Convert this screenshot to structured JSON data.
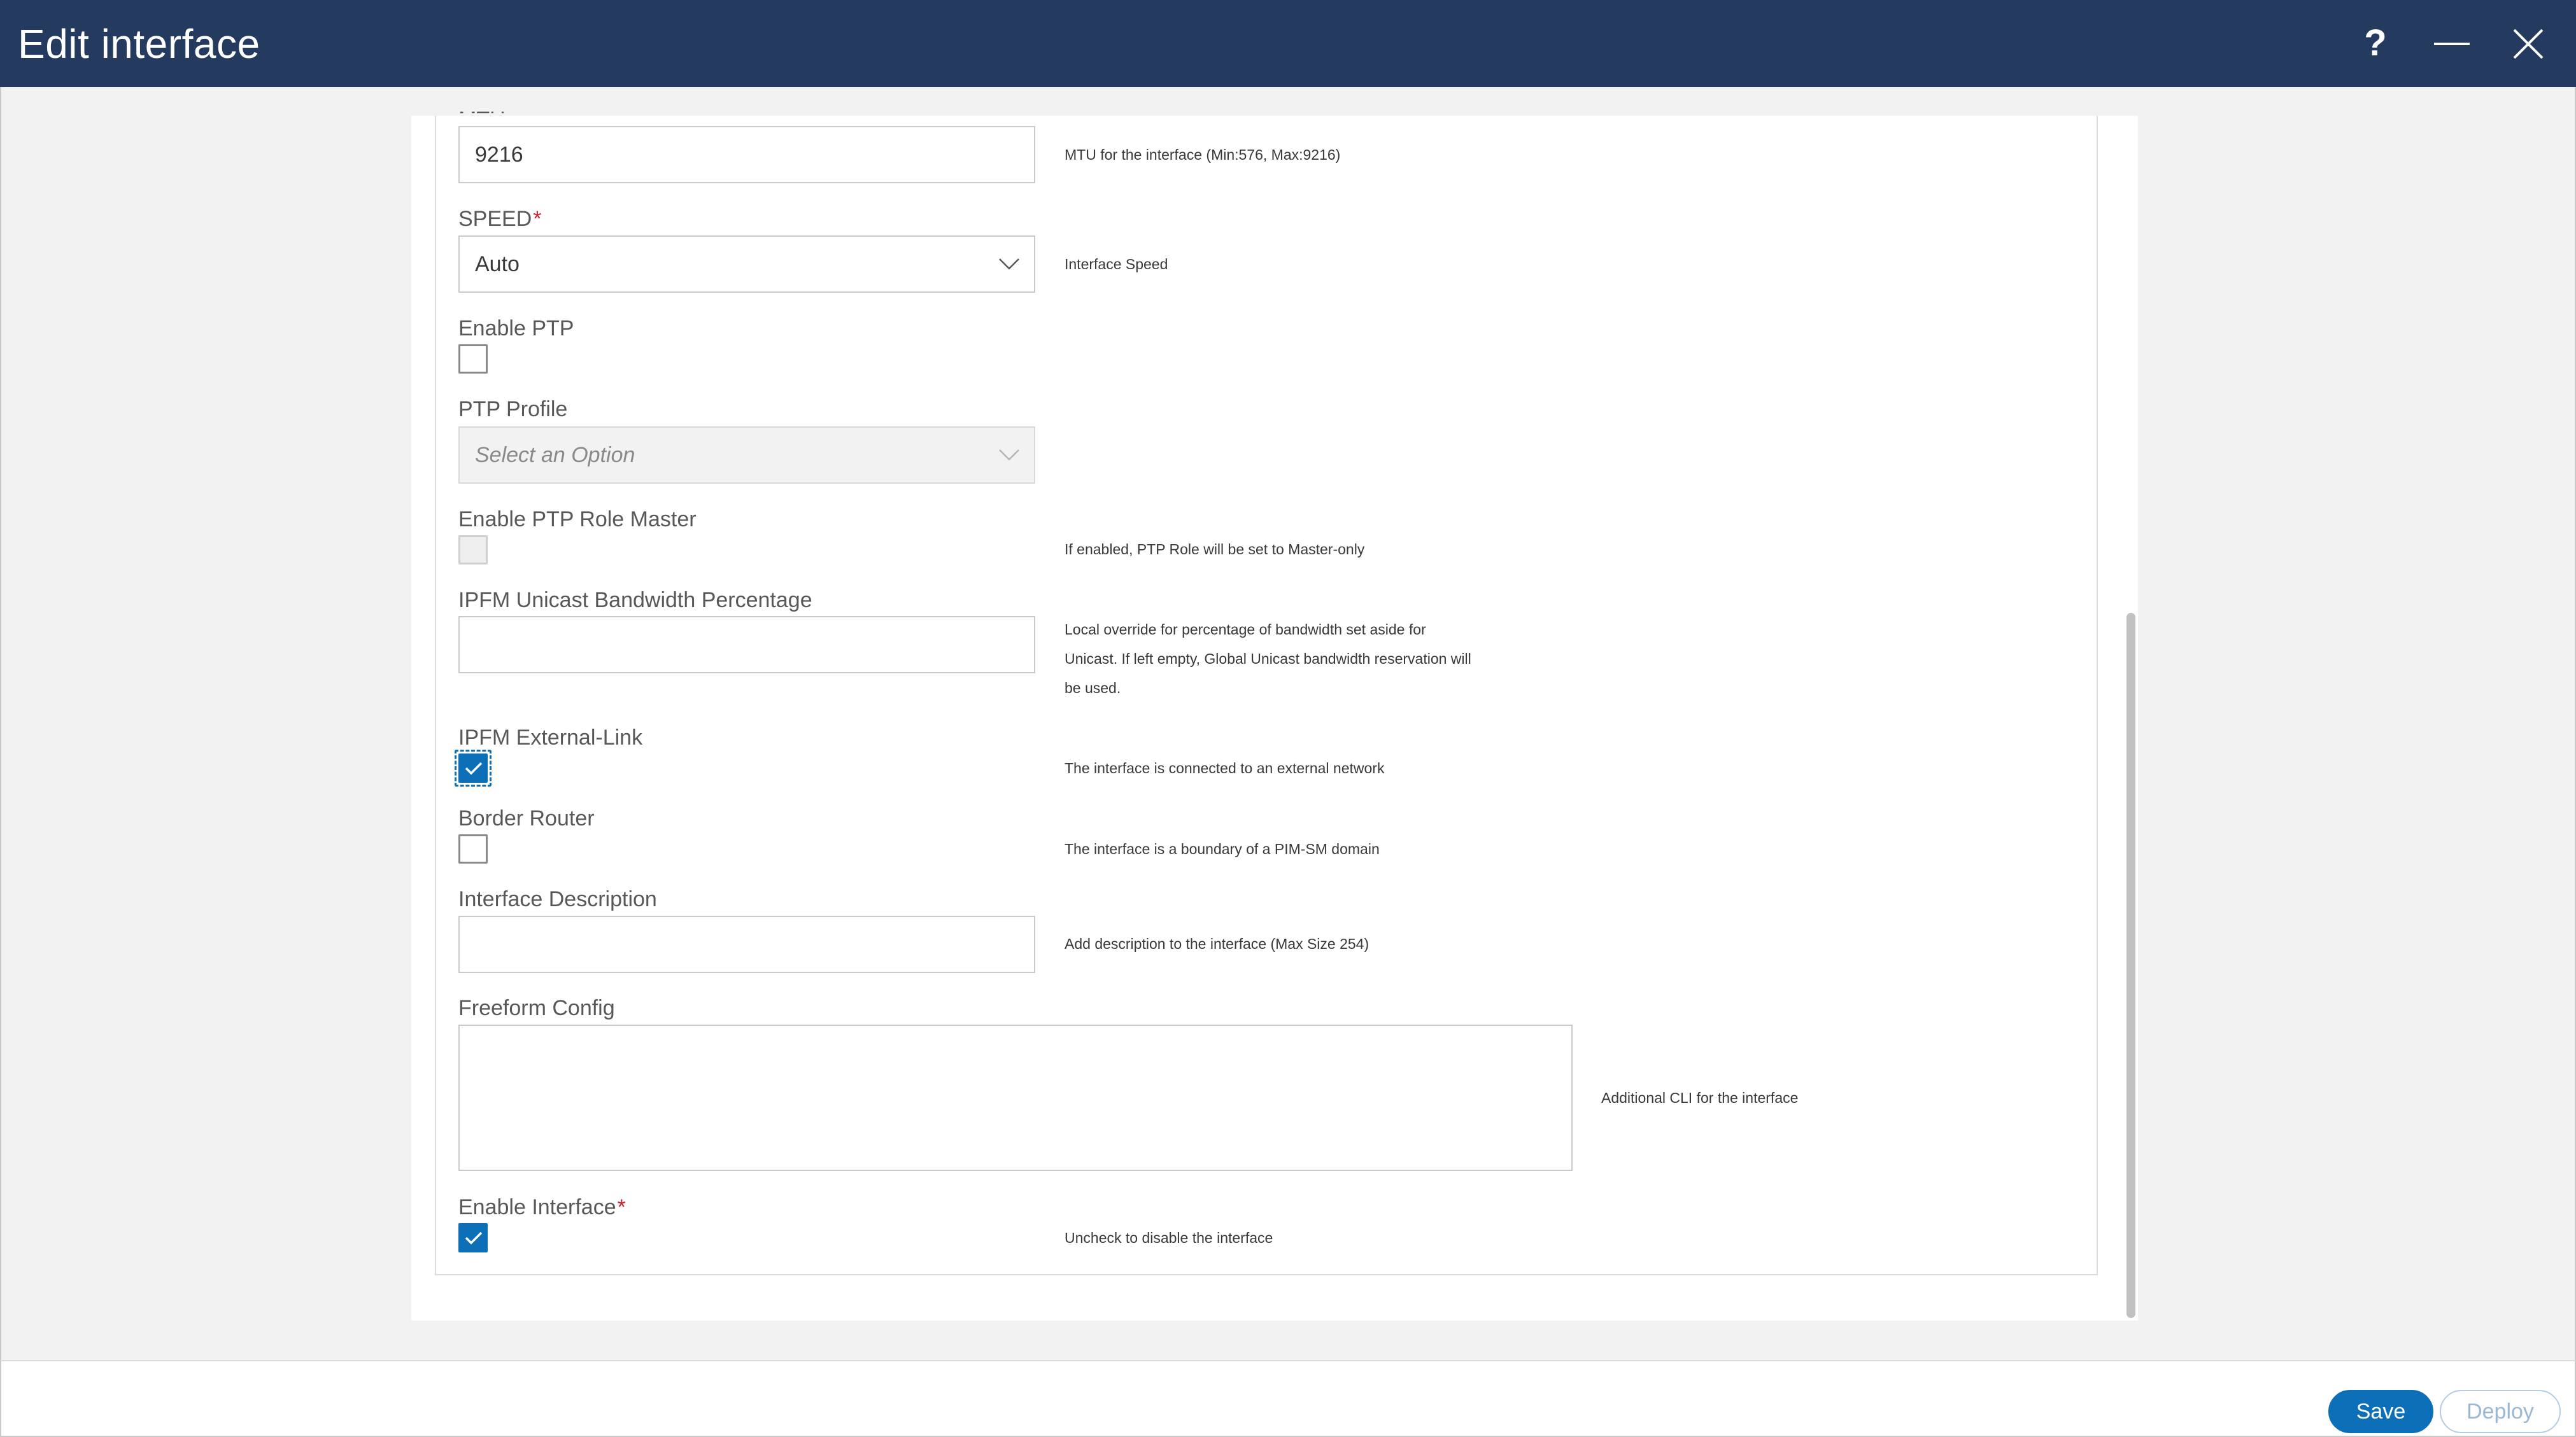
{
  "window": {
    "title": "Edit interface",
    "actions": {
      "help_icon": "question-mark",
      "minimize_icon": "minus",
      "close_icon": "x"
    }
  },
  "form": {
    "mtu": {
      "label_cutoff": "MTU",
      "value": "9216",
      "help": "MTU for the interface (Min:576, Max:9216)"
    },
    "speed": {
      "label": "SPEED",
      "required_mark": "*",
      "value": "Auto",
      "help": "Interface Speed"
    },
    "enable_ptp": {
      "label": "Enable PTP",
      "checked": false
    },
    "ptp_profile": {
      "label": "PTP Profile",
      "placeholder": "Select an Option",
      "disabled": true
    },
    "enable_ptp_role_master": {
      "label": "Enable PTP Role Master",
      "checked": false,
      "disabled": true,
      "help": "If enabled, PTP Role will be set to Master-only"
    },
    "ipfm_unicast_bw": {
      "label": "IPFM Unicast Bandwidth Percentage",
      "value": "",
      "help_lines": [
        "Local override for percentage of bandwidth set aside for",
        "Unicast. If left empty, Global Unicast bandwidth reservation will",
        "be used."
      ]
    },
    "ipfm_external_link": {
      "label": "IPFM External-Link",
      "checked": true,
      "help": "The interface is connected to an external network"
    },
    "border_router": {
      "label": "Border Router",
      "checked": false,
      "help": "The interface is a boundary of a PIM-SM domain"
    },
    "interface_description": {
      "label": "Interface Description",
      "value": "",
      "help": "Add description to the interface (Max Size 254)"
    },
    "freeform_config": {
      "label": "Freeform Config",
      "value": "",
      "help": "Additional CLI for the interface"
    },
    "enable_interface": {
      "label": "Enable Interface",
      "required_mark": "*",
      "checked": true,
      "help": "Uncheck to disable the interface"
    }
  },
  "footer": {
    "save_label": "Save",
    "deploy_label": "Deploy"
  },
  "colors": {
    "titlebar": "#243a5e",
    "primary": "#0d6fb8",
    "required": "#cf2030"
  }
}
